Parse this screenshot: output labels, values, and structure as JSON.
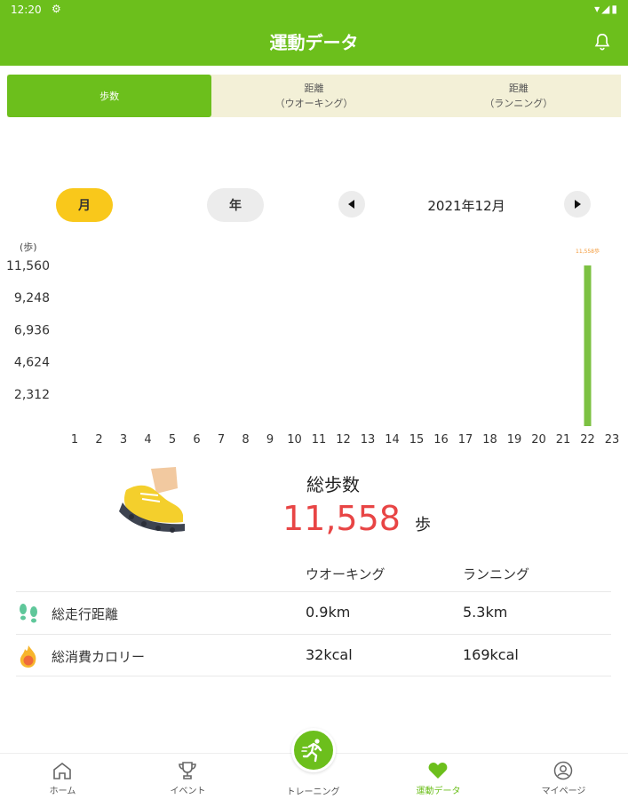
{
  "status": {
    "time": "12:20"
  },
  "app": {
    "title": "運動データ"
  },
  "tabs": [
    {
      "line1": "歩数",
      "line2": "",
      "active": true
    },
    {
      "line1": "距離",
      "line2": "（ウオーキング）",
      "active": false
    },
    {
      "line1": "距離",
      "line2": "（ランニング）",
      "active": false
    }
  ],
  "period": {
    "month_label": "月",
    "year_label": "年",
    "current": "2021年12月",
    "selected": "月"
  },
  "chart_data": {
    "type": "bar",
    "ylabel": "(歩)",
    "yticks": [
      "11,560",
      "9,248",
      "6,936",
      "4,624",
      "2,312"
    ],
    "ytick_values": [
      11560,
      9248,
      6936,
      4624,
      2312
    ],
    "ylim": [
      0,
      11560
    ],
    "categories": [
      "1",
      "2",
      "3",
      "4",
      "5",
      "6",
      "7",
      "8",
      "9",
      "10",
      "11",
      "12",
      "13",
      "14",
      "15",
      "16",
      "17",
      "18",
      "19",
      "20",
      "21",
      "22",
      "23"
    ],
    "values": [
      0,
      0,
      0,
      0,
      0,
      0,
      0,
      0,
      0,
      0,
      0,
      0,
      0,
      0,
      0,
      0,
      0,
      0,
      0,
      0,
      0,
      11558,
      0
    ],
    "data_labels": {
      "22": "11,558歩"
    },
    "grid": false,
    "colors": {
      "bar": "#7cc142",
      "label": "#f39a3a"
    }
  },
  "total": {
    "label": "総歩数",
    "value": "11,558",
    "unit": "歩"
  },
  "table": {
    "columns": [
      "ウオーキング",
      "ランニング"
    ],
    "rows": [
      {
        "label": "総走行距離",
        "walking": "0.9km",
        "running": "5.3km",
        "icon": "footprints-icon"
      },
      {
        "label": "総消費カロリー",
        "walking": "32kcal",
        "running": "169kcal",
        "icon": "flame-icon"
      }
    ]
  },
  "nav": [
    {
      "label": "ホーム",
      "icon": "home-icon"
    },
    {
      "label": "イベント",
      "icon": "trophy-icon"
    },
    {
      "label": "トレーニング",
      "icon": "runner-icon"
    },
    {
      "label": "運動データ",
      "icon": "heart-icon",
      "active": true
    },
    {
      "label": "マイページ",
      "icon": "user-icon"
    }
  ],
  "colors": {
    "brand": "#6cbf1c",
    "accent": "#f9c81b",
    "total_value": "#e84545",
    "tab_bg": "#f3f0d7"
  }
}
